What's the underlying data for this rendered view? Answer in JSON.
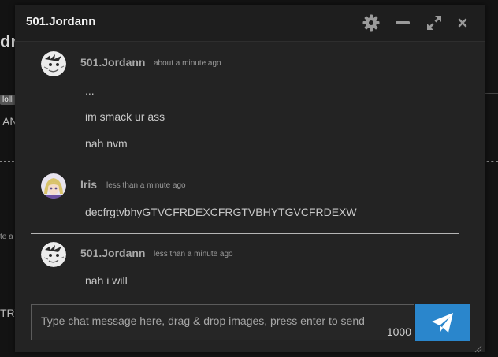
{
  "background": {
    "title_fragment": "dr",
    "tag_fragment": "lolli",
    "text_fragment": "AN",
    "small_fragment": "te a",
    "bottom_fragment": "TRY"
  },
  "window": {
    "title": "501.Jordann",
    "buttons": [
      "gear-icon",
      "minimize-icon",
      "expand-icon",
      "close-icon"
    ]
  },
  "messages": [
    {
      "user": "501.Jordann",
      "time": "about a minute ago",
      "avatar": "sketch-avatar",
      "lines": [
        "...",
        "im smack ur ass",
        "nah nvm"
      ]
    },
    {
      "user": "Iris",
      "time": "less than a minute ago",
      "avatar": "anime-avatar",
      "lines": [
        "decfrgtvbhyGTVCFRDEXCFRGTVBHYTGVCFRDEXW"
      ]
    },
    {
      "user": "501.Jordann",
      "time": "less than a minute ago",
      "avatar": "sketch-avatar",
      "lines": [
        "nah i will"
      ]
    }
  ],
  "composer": {
    "placeholder": "Type chat message here, drag & drop images, press enter to send",
    "char_limit": "1000",
    "send_icon": "paper-plane-icon",
    "accent": "#2a86cc"
  }
}
